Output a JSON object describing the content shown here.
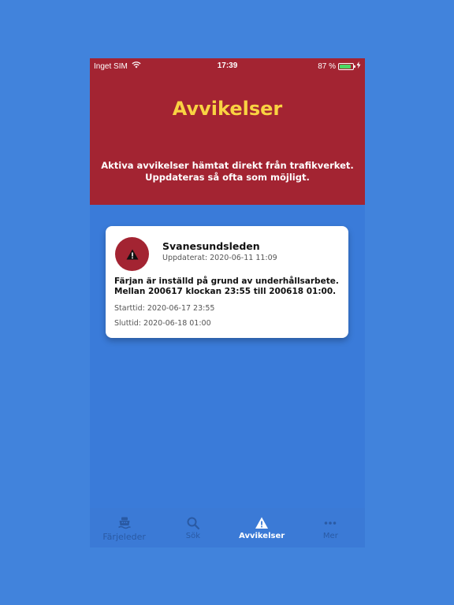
{
  "status_bar": {
    "carrier": "Inget SIM",
    "time": "17:39",
    "battery": "87 %",
    "battery_level": 0.87
  },
  "header": {
    "title": "Avvikelser",
    "subtitle_line1": "Aktiva avvikelser hämtat direkt från trafikverket.",
    "subtitle_line2": "Uppdateras så ofta som möjligt."
  },
  "deviation": {
    "route": "Svanesundsleden",
    "updated": "Uppdaterat: 2020-06-11 11:09",
    "message_line1": "Färjan är inställd på grund av underhållsarbete.",
    "message_line2": "Mellan 200617 klockan 23:55 till 200618 01:00.",
    "start": "Starttid: 2020-06-17 23:55",
    "end": "Sluttid: 2020-06-18 01:00"
  },
  "tabs": [
    {
      "label": "Färjeleder",
      "icon": "ferry-icon"
    },
    {
      "label": "Sök",
      "icon": "search-icon"
    },
    {
      "label": "Avvikelser",
      "icon": "warning-icon",
      "active": true
    },
    {
      "label": "Mer",
      "icon": "more-icon"
    }
  ],
  "colors": {
    "background": "#4183dc",
    "header": "#a32432",
    "title": "#f9d342",
    "tab_inactive": "#2a5aa4",
    "battery": "#4cd964"
  }
}
